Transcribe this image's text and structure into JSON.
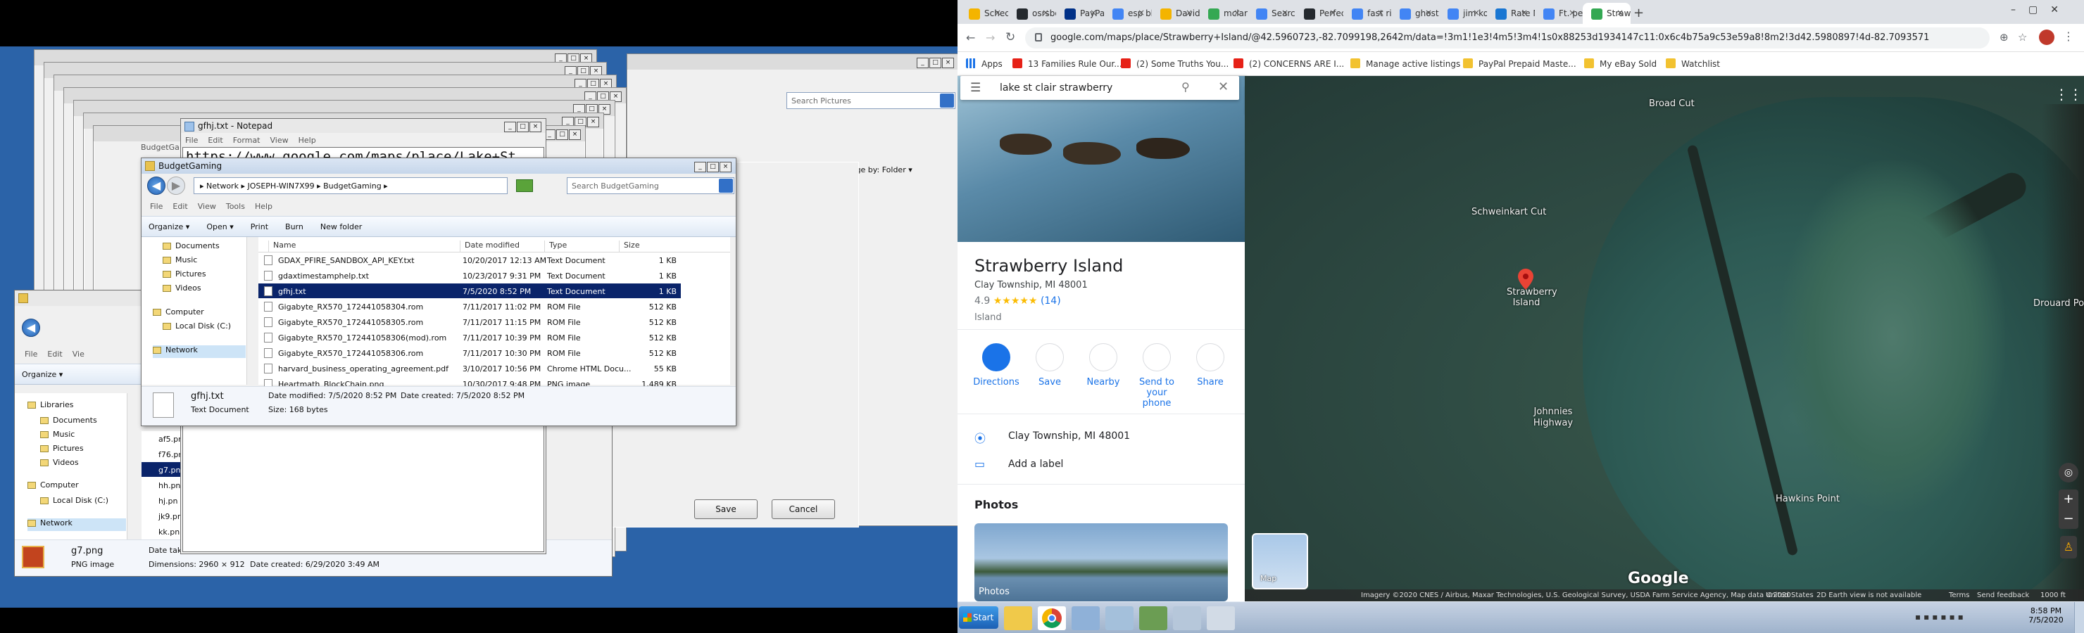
{
  "desktop": {
    "notepad": {
      "title": "gfhj.txt - Notepad",
      "menu": [
        "File",
        "Edit",
        "Format",
        "View",
        "Help"
      ],
      "content": "https://www.google.com/maps/place/Lake+St"
    },
    "budget_window": {
      "title": "BudgetGaming",
      "breadcrumb": "▸ Network ▸ JOSEPH-WIN7X99 ▸ BudgetGaming ▸",
      "search_placeholder": "Search BudgetGaming",
      "menu": [
        "File",
        "Edit",
        "View",
        "Tools",
        "Help"
      ],
      "toolbar": [
        "Organize ▾",
        "Open ▾",
        "Print",
        "Burn",
        "New folder"
      ],
      "nav": [
        "Documents",
        "Music",
        "Pictures",
        "Videos",
        "Computer",
        "Local Disk (C:)",
        "Network"
      ],
      "columns": [
        "Name",
        "Date modified",
        "Type",
        "Size"
      ],
      "files": [
        {
          "name": "GDAX_PFIRE_SANDBOX_API_KEY.txt",
          "date": "10/20/2017 12:13 AM",
          "type": "Text Document",
          "size": "1 KB",
          "selected": false
        },
        {
          "name": "gdaxtimestamphelp.txt",
          "date": "10/23/2017 9:31 PM",
          "type": "Text Document",
          "size": "1 KB",
          "selected": false
        },
        {
          "name": "gfhj.txt",
          "date": "7/5/2020 8:52 PM",
          "type": "Text Document",
          "size": "1 KB",
          "selected": true
        },
        {
          "name": "Gigabyte_RX570_172441058304.rom",
          "date": "7/11/2017 11:02 PM",
          "type": "ROM File",
          "size": "512 KB",
          "selected": false
        },
        {
          "name": "Gigabyte_RX570_172441058305.rom",
          "date": "7/11/2017 11:15 PM",
          "type": "ROM File",
          "size": "512 KB",
          "selected": false
        },
        {
          "name": "Gigabyte_RX570_172441058306(mod).rom",
          "date": "7/11/2017 10:39 PM",
          "type": "ROM File",
          "size": "512 KB",
          "selected": false
        },
        {
          "name": "Gigabyte_RX570_172441058306.rom",
          "date": "7/11/2017 10:30 PM",
          "type": "ROM File",
          "size": "512 KB",
          "selected": false
        },
        {
          "name": "harvard_business_operating_agreement.pdf",
          "date": "3/10/2017 10:56 PM",
          "type": "Chrome HTML Docu...",
          "size": "55 KB",
          "selected": false
        },
        {
          "name": "Heartmath_BlockChain.png",
          "date": "10/30/2017 9:48 PM",
          "type": "PNG image",
          "size": "1,489 KB",
          "selected": false
        }
      ],
      "details": {
        "name": "gfhj.txt",
        "type": "Text Document",
        "modified": "Date modified: 7/5/2020 8:52 PM",
        "created": "Date created: 7/5/2020 8:52 PM",
        "size": "Size: 168 bytes"
      }
    },
    "pictures_window": {
      "search_placeholder": "Search Pictures",
      "arrange_label": "rrange by:",
      "arrange_value": "Folder ▾"
    },
    "budget_bg_label": "udgetGaming",
    "budget_bg_label2": "BudgetGa",
    "save_dialog": {
      "save_label": "Save",
      "cancel_label": "Cancel"
    },
    "libraries_window": {
      "menu": [
        "File",
        "Edit",
        "Vie"
      ],
      "organize": "Organize ▾",
      "nav": [
        "Libraries",
        "Documents",
        "Music",
        "Pictures",
        "Videos",
        "Computer",
        "Local Disk (C:)",
        "Network"
      ],
      "partial_files": [
        "af5.pr",
        "f76.pr",
        "g7.pn",
        "hh.pn",
        "hj.pn",
        "jk9.pn",
        "kk.pn"
      ],
      "details": {
        "name": "g7.png",
        "date_taken": "Date taken: Specify",
        "type": "PNG image",
        "dimensions": "Dimensions: 2960 × 912",
        "created": "Date created: 6/29/2020 3:49 AM"
      }
    }
  },
  "chrome": {
    "tabs": [
      "Schedu",
      "osrsbo",
      "PayPal",
      "esp blu",
      "David M",
      "mclaren",
      "Search",
      "Perfect",
      "fast rig",
      "ghosts",
      "jim kon",
      "Rate M",
      "Ft. perc",
      "Strawb"
    ],
    "url": "google.com/maps/place/Strawberry+Island/@42.5960723,-82.7099198,2642m/data=!3m1!1e3!4m5!3m4!1s0x88253d1934147c11:0x6c4b75a9c53e59a8!8m2!3d42.5980897!4d-82.7093571",
    "bookmarks": [
      "Apps",
      "13 Families Rule Our...",
      "(2) Some Truths You...",
      "(2) CONCERNS ARE I...",
      "Manage active listings",
      "PayPal Prepaid Maste...",
      "My eBay Sold",
      "Watchlist"
    ]
  },
  "maps": {
    "search_value": "lake st clair strawberry",
    "place_name": "Strawberry Island",
    "address_short": "Clay Township, MI 48001",
    "rating": "4.9",
    "stars": "★★★★★",
    "review_count": "(14)",
    "category": "Island",
    "actions": [
      "Directions",
      "Save",
      "Nearby",
      "Send to your phone",
      "Share"
    ],
    "address_full": "Clay Township, MI 48001",
    "add_label": "Add a label",
    "photos_heading": "Photos",
    "photos_caption": "Photos",
    "map_labels": [
      "Broad Cut",
      "Schweinkart Cut",
      "Strawberry Island",
      "Drouard Point",
      "Johnnies Highway",
      "Hawkins Point"
    ],
    "map_toggle": "Map",
    "logo": "Google",
    "footer": [
      "Imagery ©2020 CNES / Airbus, Maxar Technologies, U.S. Geological Survey, USDA Farm Service Agency, Map data ©2020",
      "United States",
      "2D Earth view is not available",
      "Terms",
      "Send feedback",
      "1000 ft"
    ]
  },
  "taskbar": {
    "start": "Start",
    "time": "8:58 PM",
    "date": "7/5/2020"
  },
  "colors": {
    "desktop": "#2b63a8",
    "selection": "#0a246a",
    "maps_accent": "#1a73e8",
    "pin": "#ea4335",
    "water": "#2f4c44"
  }
}
